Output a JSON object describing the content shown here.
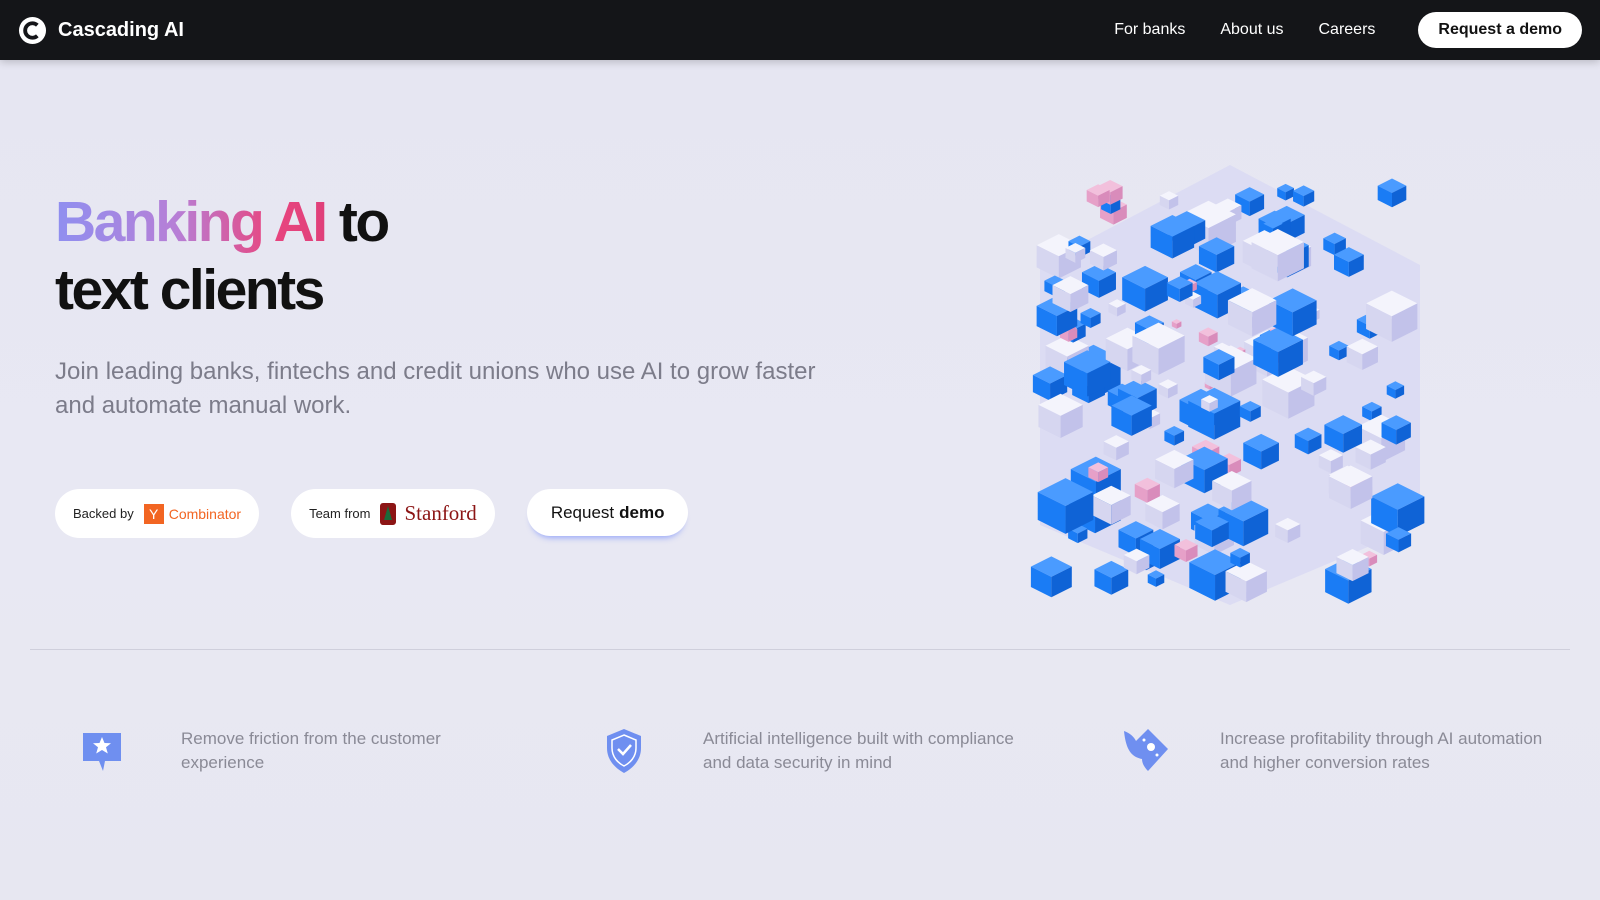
{
  "nav": {
    "brand": "Cascading AI",
    "links": [
      "For banks",
      "About us",
      "Careers"
    ],
    "cta": "Request a demo"
  },
  "hero": {
    "title_gradient": "Banking AI",
    "title_rest": " to",
    "title_line2": "text clients",
    "subtitle": "Join leading banks, fintechs and credit unions who use AI to grow faster and automate manual work.",
    "badge_yc": {
      "prefix": "Backed by",
      "logo_letter": "Y",
      "name": "Combinator"
    },
    "badge_stanford": {
      "prefix": "Team from",
      "name": "Stanford"
    },
    "demo_button": {
      "label": "Request",
      "label_bold": "demo"
    }
  },
  "features": [
    {
      "icon": "star-chat-icon",
      "text": "Remove friction from the customer experience"
    },
    {
      "icon": "shield-check-icon",
      "text": "Artificial intelligence built with compliance and data security in mind"
    },
    {
      "icon": "flying-money-icon",
      "text": "Increase profitability through AI automation and higher conversion rates"
    }
  ],
  "colors": {
    "accent_blue": "#6f8ff0",
    "cube_blue": "#1a7cf5",
    "nav_bg": "#141518",
    "yc_orange": "#f26522",
    "stanford_red": "#8c1515"
  }
}
